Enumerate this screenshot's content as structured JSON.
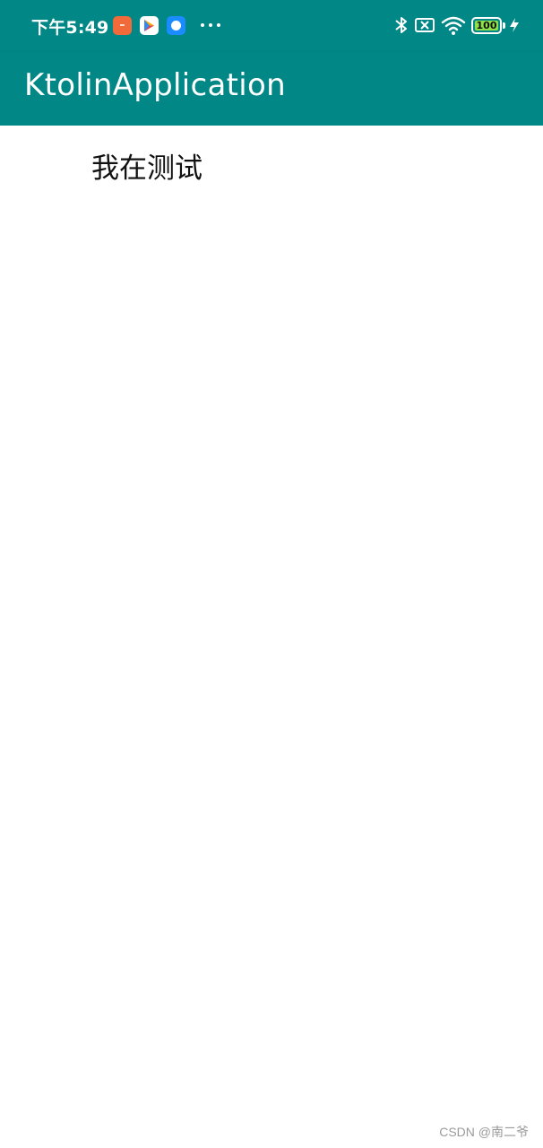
{
  "status_bar": {
    "time": "下午5:49",
    "notification_icons": [
      "xiaomi-app-icon",
      "play-store-icon",
      "message-icon"
    ],
    "more_indicator_icon": "more-dots-icon",
    "right_icons": [
      "bluetooth-icon",
      "no-sim-icon",
      "wifi-icon",
      "battery-icon",
      "charging-icon"
    ],
    "battery_level": "100"
  },
  "app_bar": {
    "title": "KtolinApplication"
  },
  "content": {
    "text": "我在测试"
  },
  "watermark": {
    "text": "CSDN @南二爷"
  },
  "colors": {
    "primary": "#018786",
    "battery_fill": "#8ee04a",
    "background": "#ffffff"
  }
}
